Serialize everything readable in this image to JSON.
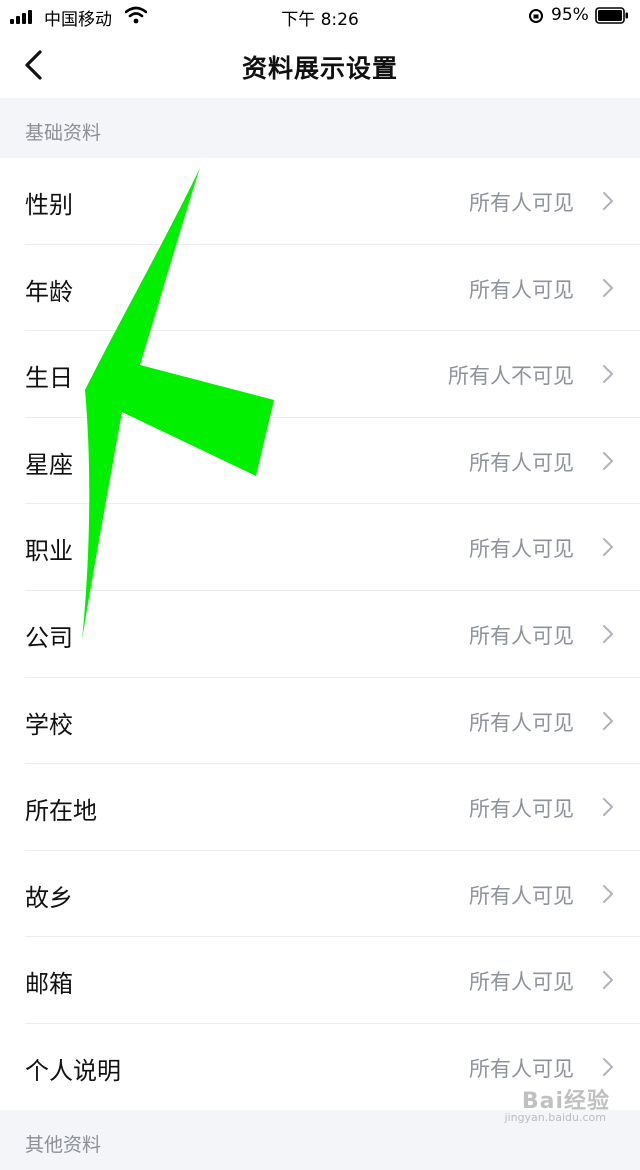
{
  "status_bar": {
    "carrier": "中国移动",
    "time": "下午 8:26",
    "battery_percent": "95%"
  },
  "nav": {
    "title": "资料展示设置"
  },
  "sections": [
    {
      "title": "基础资料"
    },
    {
      "title": "其他资料"
    }
  ],
  "rows": [
    {
      "label": "性别",
      "value": "所有人可见"
    },
    {
      "label": "年龄",
      "value": "所有人可见"
    },
    {
      "label": "生日",
      "value": "所有人不可见"
    },
    {
      "label": "星座",
      "value": "所有人可见"
    },
    {
      "label": "职业",
      "value": "所有人可见"
    },
    {
      "label": "公司",
      "value": "所有人可见"
    },
    {
      "label": "学校",
      "value": "所有人可见"
    },
    {
      "label": "所在地",
      "value": "所有人可见"
    },
    {
      "label": "故乡",
      "value": "所有人可见"
    },
    {
      "label": "邮箱",
      "value": "所有人可见"
    },
    {
      "label": "个人说明",
      "value": "所有人可见"
    }
  ],
  "annotation_color": "#00f000",
  "watermark": {
    "text": "Bai经验",
    "sub": "jingyan.baidu.com"
  }
}
